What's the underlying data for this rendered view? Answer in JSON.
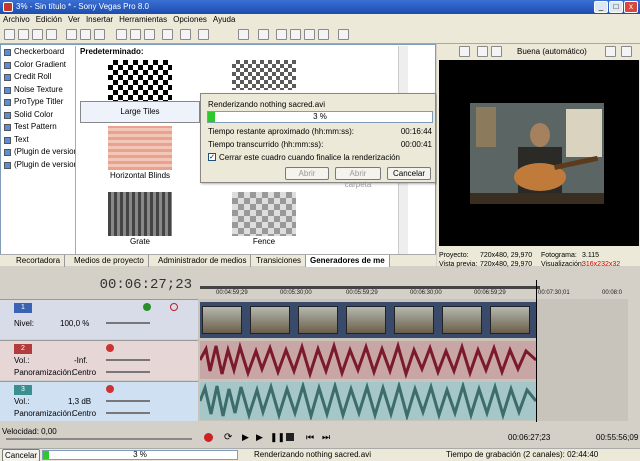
{
  "window": {
    "title": "3% - Sin título * - Sony Vegas Pro 8.0",
    "min": "_",
    "max": "□",
    "close": "x"
  },
  "menu": [
    "Archivo",
    "Edición",
    "Ver",
    "Insertar",
    "Herramientas",
    "Opciones",
    "Ayuda"
  ],
  "fx": {
    "header": "Predeterminado:",
    "items": [
      "Checkerboard",
      "Color Gradient",
      "Credit Roll",
      "Noise Texture",
      "ProType Titler",
      "Solid Color",
      "Test Pattern",
      "Text",
      "(Plugin de versione",
      "(Plugin de versione"
    ],
    "presets": [
      {
        "label": "Large Tiles"
      },
      {
        "label": "Horizontal Blinds"
      },
      {
        "label": "Grate"
      },
      {
        "label": "Fence"
      }
    ]
  },
  "tabs": [
    "Recortadora",
    "Medios de proyecto",
    "Administrador de medios",
    "Transiciones",
    "Generadores de me"
  ],
  "dialog": {
    "title": "Renderizando nothing sacred.avi",
    "progress_text": "3 %",
    "progress": 0.03,
    "remaining_label": "Tiempo restante aproximado (hh:mm:ss):",
    "remaining_value": "00:16:44",
    "elapsed_label": "Tiempo transcurrido (hh:mm:ss):",
    "elapsed_value": "00:00:41",
    "checkbox_label": "Cerrar este cuadro cuando finalice la renderización",
    "btn_open": "Abrir",
    "btn_open_folder": "Abrir carpeta",
    "btn_cancel": "Cancelar"
  },
  "preview": {
    "quality": "Buena (automático)",
    "proyecto_label": "Proyecto:",
    "proyecto_val": "720x480, 29,970",
    "fotograma_label": "Fotograma:",
    "fotograma_val": "3.115",
    "vista_label": "Vista previa:",
    "vista_val": "720x480, 29,970",
    "visual_label": "Visualización:",
    "visual_val": "316x232x32"
  },
  "timeline": {
    "timecode": "00:06:27;23",
    "ruler": [
      "00:04:59;29",
      "00:05:30;00",
      "00:05:59;29",
      "00:06:30;00",
      "00:06:59;29",
      "00:07:30;01",
      "00:08:0"
    ],
    "tracks": [
      {
        "num": "1",
        "param_label": "Nivel:",
        "param_value": "100,0 %"
      },
      {
        "num": "2",
        "vol_label": "Vol.:",
        "vol_value": "-Inf.",
        "pan_label": "Panoramización:",
        "pan_value": "Centro"
      },
      {
        "num": "3",
        "vol_label": "Vol.:",
        "vol_value": "1,3 dB",
        "pan_label": "Panoramización:",
        "pan_value": "Centro"
      }
    ],
    "velocity": "Velocidad: 0,00",
    "pos_tc": "00:06:27;23",
    "end_tc": "00:55:56;09"
  },
  "status": {
    "cancel": "Cancelar",
    "progress_text": "3 %",
    "progress": 0.03,
    "render_text": "Renderizando nothing sacred.avi",
    "record_time": "Tiempo de grabación (2 canales): 02:44:40"
  }
}
